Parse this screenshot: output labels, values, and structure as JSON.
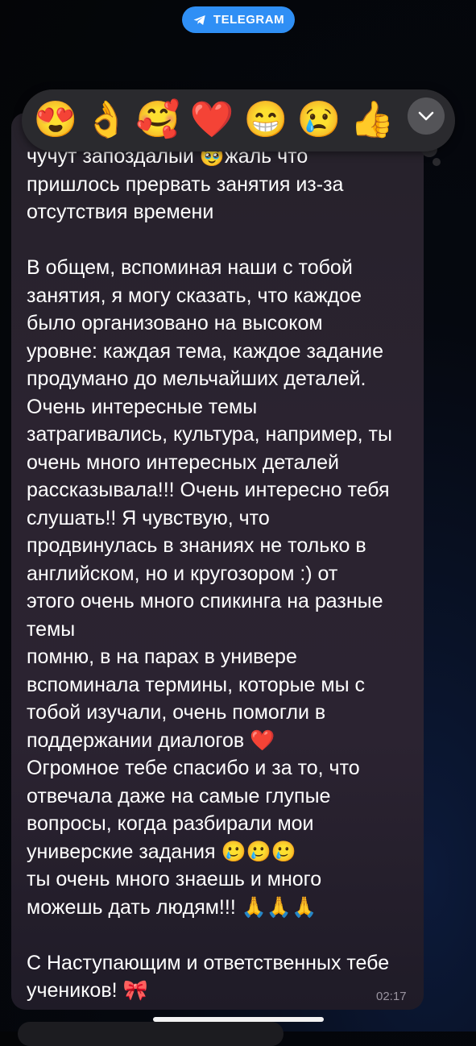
{
  "header": {
    "app_label": "TELEGRAM"
  },
  "reactions": [
    "😍",
    "👌",
    "🥰",
    "❤️",
    "😁",
    "😢",
    "👍"
  ],
  "message": {
    "text": "чучут запоздалый 🥹жаль что\nпришлось прервать занятия из-за\nотсутствия времени\n\nВ общем, вспоминая наши с тобой\nзанятия, я могу сказать, что каждое\nбыло организовано на высоком\nуровне: каждая тема, каждое задание\nпродумано до мельчайших деталей.\nОчень интересные темы\nзатрагивались, культура, например, ты\nочень много интересных деталей\nрассказывала!!! Очень интересно тебя\nслушать!! Я чувствую, что\nпродвинулась в знаниях не только в\nанглийском, но и кругозором :) от\nэтого очень много спикинга на разные\nтемы\nпомню, в на парах в универе\nвспоминала термины, которые мы с\nтобой изучали, очень помогли в\nподдержании диалогов ❤️\nОгромное тебе спасибо и за то, что\nотвечала даже на самые глупые\nвопросы, когда разбирали мои\nуниверские задания 🥲🥲🥲\nты очень много знаешь и много\nможешь дать людям!!! 🙏🙏🙏\n\nС Наступающим и ответственных тебе\nучеников! 🎀",
    "time": "02:17"
  },
  "colors": {
    "accent": "#2f8ff5",
    "bubble": "#2b2330"
  }
}
